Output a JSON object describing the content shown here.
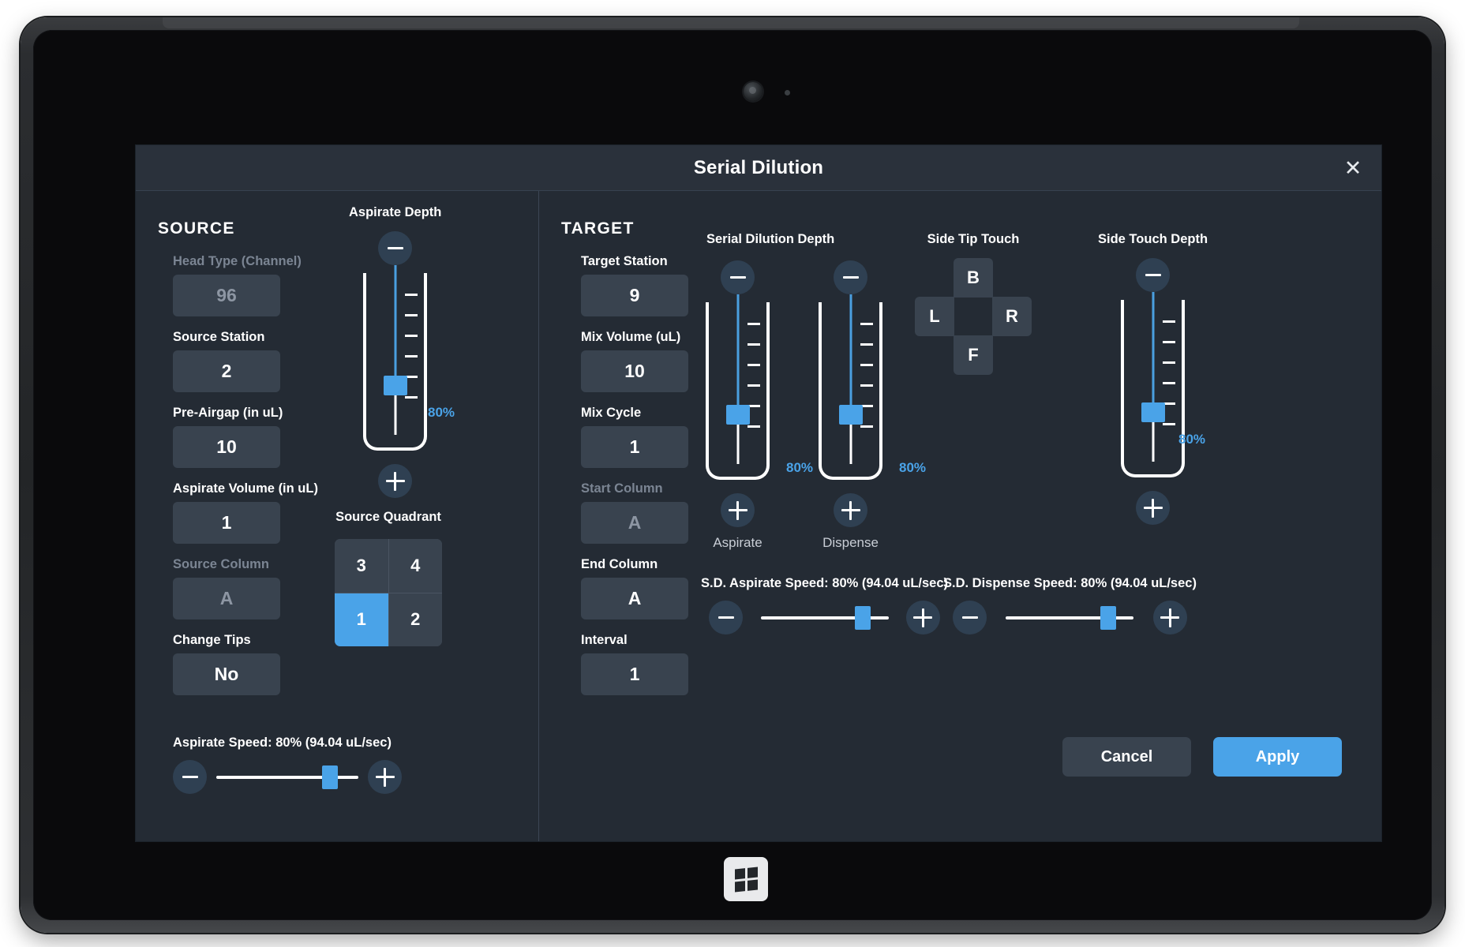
{
  "dialog": {
    "title": "Serial Dilution",
    "close_icon": "close-icon"
  },
  "source": {
    "heading": "SOURCE",
    "fields": [
      {
        "label": "Head Type (Channel)",
        "value": "96",
        "disabled": true
      },
      {
        "label": "Source Station",
        "value": "2",
        "disabled": false
      },
      {
        "label": "Pre-Airgap (in uL)",
        "value": "10",
        "disabled": false
      },
      {
        "label": "Aspirate Volume (in uL)",
        "value": "1",
        "disabled": false
      },
      {
        "label": "Source Column",
        "value": "A",
        "disabled": true
      },
      {
        "label": "Change Tips",
        "value": "No",
        "disabled": false
      }
    ],
    "aspirate_depth": {
      "title": "Aspirate Depth",
      "decrement_icon": "minus-icon",
      "increment_icon": "plus-icon",
      "percent": "80%",
      "percent_value": 80,
      "tick_count": 6
    },
    "source_quadrant": {
      "title": "Source Quadrant",
      "cells": [
        "3",
        "4",
        "1",
        "2"
      ],
      "selected": "1"
    },
    "aspirate_speed": {
      "label": "Aspirate Speed: 80% (94.04 uL/sec)",
      "percent_value": 80,
      "decrement_icon": "minus-icon",
      "increment_icon": "plus-icon"
    }
  },
  "target": {
    "heading": "TARGET",
    "fields": [
      {
        "label": "Target Station",
        "value": "9",
        "disabled": false
      },
      {
        "label": "Mix Volume (uL)",
        "value": "10",
        "disabled": false
      },
      {
        "label": "Mix Cycle",
        "value": "1",
        "disabled": false
      },
      {
        "label": "Start Column",
        "value": "A",
        "disabled": true
      },
      {
        "label": "End Column",
        "value": "A",
        "disabled": false
      },
      {
        "label": "Interval",
        "value": "1",
        "disabled": false
      }
    ],
    "serial_dilution_depth": {
      "title": "Serial Dilution Depth",
      "sliders": [
        {
          "caption": "Aspirate",
          "percent": "80%",
          "percent_value": 80,
          "decrement_icon": "minus-icon",
          "increment_icon": "plus-icon"
        },
        {
          "caption": "Dispense",
          "percent": "80%",
          "percent_value": 80,
          "decrement_icon": "minus-icon",
          "increment_icon": "plus-icon"
        }
      ]
    },
    "side_tip_touch": {
      "title": "Side Tip Touch",
      "keys": {
        "back": "B",
        "left": "L",
        "right": "R",
        "front": "F"
      }
    },
    "side_touch_depth": {
      "title": "Side Touch Depth",
      "percent": "80%",
      "percent_value": 80,
      "decrement_icon": "minus-icon",
      "increment_icon": "plus-icon"
    },
    "sd_aspirate_speed": {
      "label": "S.D. Aspirate Speed: 80% (94.04 uL/sec)",
      "percent_value": 80,
      "decrement_icon": "minus-icon",
      "increment_icon": "plus-icon"
    },
    "sd_dispense_speed": {
      "label": "S.D. Dispense Speed: 80% (94.04 uL/sec)",
      "percent_value": 80,
      "decrement_icon": "minus-icon",
      "increment_icon": "plus-icon"
    }
  },
  "footer": {
    "cancel_label": "Cancel",
    "apply_label": "Apply"
  },
  "theme": {
    "accent": "#4aa3e8",
    "panel": "#242b34",
    "field": "#39434f",
    "titlebar": "#2a313b",
    "disabled_text": "#8d96a3"
  }
}
